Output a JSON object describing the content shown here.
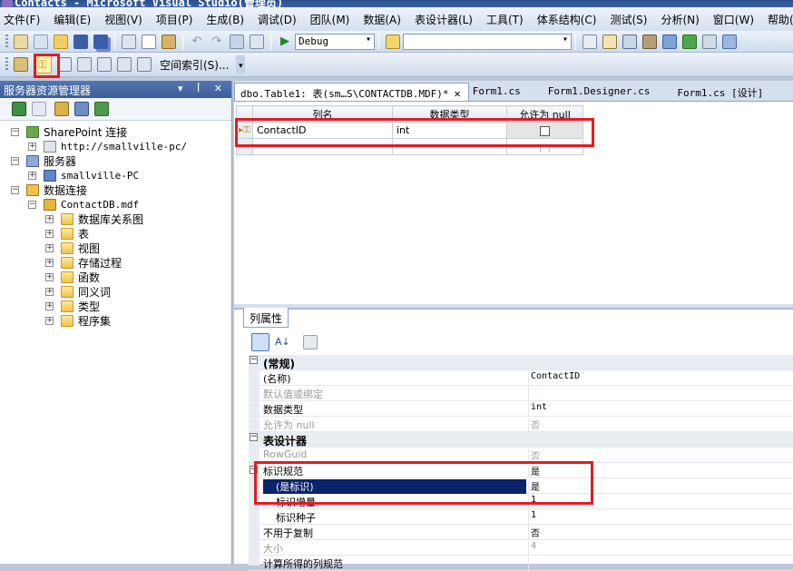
{
  "window": {
    "title": "Contacts - Microsoft Visual Studio(管理员)"
  },
  "menu": [
    "文件(F)",
    "编辑(E)",
    "视图(V)",
    "项目(P)",
    "生成(B)",
    "调试(D)",
    "团队(M)",
    "数据(A)",
    "表设计器(L)",
    "工具(T)",
    "体系结构(C)",
    "测试(S)",
    "分析(N)",
    "窗口(W)",
    "帮助(H)"
  ],
  "toolbar": {
    "config": "Debug",
    "search_value": "",
    "index_label": "空间索引(S)..."
  },
  "server_explorer": {
    "title": "服务器资源管理器",
    "sharepoint": "SharePoint 连接",
    "sharepoint_url": "http://smallville-pc/",
    "servers": "服务器",
    "server_name": "smallville-PC",
    "data_connections": "数据连接",
    "db": "ContactDB.mdf",
    "db_children": [
      "数据库关系图",
      "表",
      "视图",
      "存储过程",
      "函数",
      "同义词",
      "类型",
      "程序集"
    ]
  },
  "tabs": [
    {
      "label": "dbo.Table1: 表(sm…S\\CONTACTDB.MDF)*",
      "active": true
    },
    {
      "label": "Form1.cs"
    },
    {
      "label": "Form1.Designer.cs"
    },
    {
      "label": "Form1.cs [设计]"
    }
  ],
  "table_designer": {
    "headers": [
      "列名",
      "数据类型",
      "允许为 null"
    ],
    "rows": [
      {
        "name": "ContactID",
        "type": "int",
        "allow_null": false
      }
    ]
  },
  "column_properties": {
    "tab": "列属性",
    "rows": [
      {
        "k": "(常规)",
        "cat": true
      },
      {
        "k": "(名称)",
        "v": "ContactID"
      },
      {
        "k": "默认值或绑定",
        "v": "",
        "dis": true
      },
      {
        "k": "数据类型",
        "v": "int"
      },
      {
        "k": "允许为 null",
        "v": "否",
        "dis": true
      },
      {
        "k": "表设计器",
        "cat": true
      },
      {
        "k": "RowGuid",
        "v": "否",
        "dis": true
      },
      {
        "k": "标识规范",
        "v": "是"
      },
      {
        "k": "(是标识)",
        "v": "是",
        "sel": true
      },
      {
        "k": "标识增量",
        "v": "1"
      },
      {
        "k": "标识种子",
        "v": "1"
      },
      {
        "k": "不用于复制",
        "v": "否"
      },
      {
        "k": "大小",
        "v": "4",
        "dis": true
      },
      {
        "k": "计算所得的列规范",
        "v": ""
      }
    ]
  },
  "colors": {
    "highlight": "#e21b23",
    "selection": "#0a246a"
  }
}
